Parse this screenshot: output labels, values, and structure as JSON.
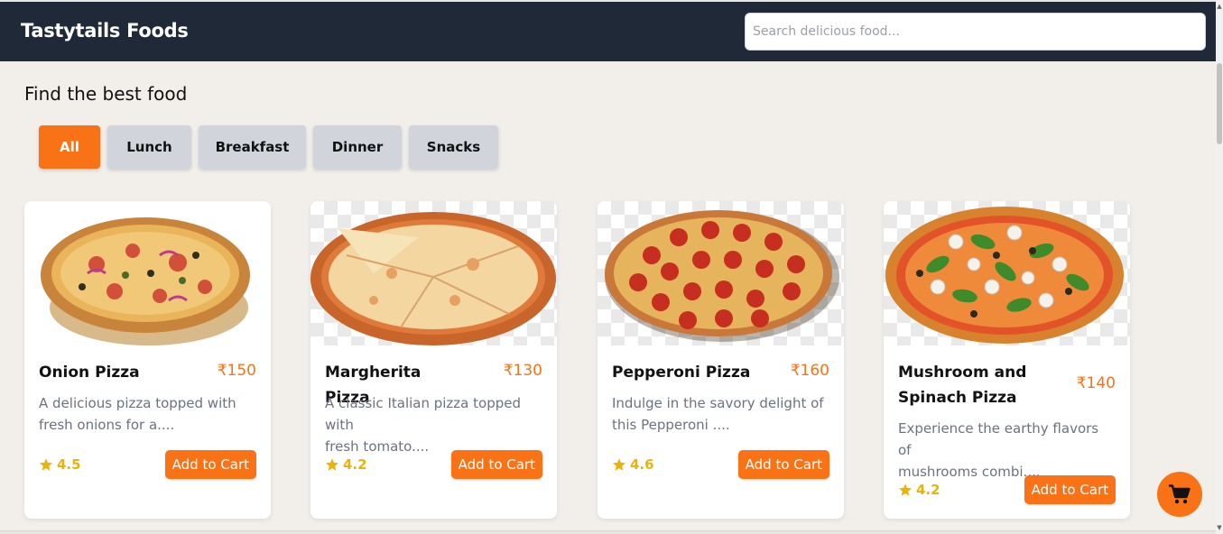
{
  "header": {
    "brand": "Tastytails Foods",
    "search_placeholder": "Search delicious food..."
  },
  "main": {
    "heading": "Find the best food",
    "filters": [
      {
        "label": "All",
        "active": true
      },
      {
        "label": "Lunch",
        "active": false
      },
      {
        "label": "Breakfast",
        "active": false
      },
      {
        "label": "Dinner",
        "active": false
      },
      {
        "label": "Snacks",
        "active": false
      }
    ],
    "products": [
      {
        "name": "Onion Pizza",
        "price": "₹150",
        "description_line1": "A delicious pizza topped with",
        "description_line2": "fresh onions for a....",
        "rating": "4.5",
        "cta": "Add to Cart"
      },
      {
        "name": "Margherita Pizza",
        "price": "₹130",
        "description_line1": "A classic Italian pizza topped with",
        "description_line2": "fresh tomato....",
        "rating": "4.2",
        "cta": "Add to Cart"
      },
      {
        "name": "Pepperoni Pizza",
        "price": "₹160",
        "description_line1": "Indulge in the savory delight of",
        "description_line2": "this Pepperoni ....",
        "rating": "4.6",
        "cta": "Add to Cart"
      },
      {
        "name": "Mushroom and Spinach Pizza",
        "price": "₹140",
        "description_line1": "Experience the earthy flavors of",
        "description_line2": "mushrooms combi....",
        "rating": "4.2",
        "cta": "Add to Cart"
      }
    ]
  },
  "icons": {
    "rating": "star-icon",
    "cart": "shopping-cart-icon"
  },
  "colors": {
    "accent": "#f97316",
    "header_bg": "#1f2937",
    "star": "#eab308",
    "page_bg": "#f2efeb",
    "chip_bg": "#d1d5db"
  }
}
